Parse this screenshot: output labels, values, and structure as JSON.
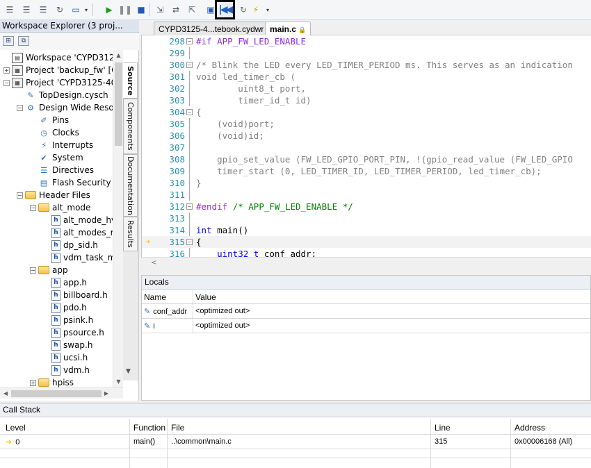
{
  "workspace_explorer": {
    "title": "Workspace Explorer (3 proj...",
    "tree": [
      {
        "label": "Workspace 'CYPD3125-40",
        "icon": "workspace-icon",
        "depth": 0,
        "expander": ""
      },
      {
        "label": "Project 'backup_fw' [C",
        "icon": "project-icon",
        "depth": 0,
        "expander": "+"
      },
      {
        "label": "Project 'CYPD3125-40",
        "icon": "project-icon",
        "depth": 0,
        "expander": "−"
      },
      {
        "label": "TopDesign.cysch",
        "icon": "schematic-icon",
        "depth": 1,
        "expander": ""
      },
      {
        "label": "Design Wide Resou",
        "icon": "dwr-icon",
        "depth": 1,
        "expander": "−"
      },
      {
        "label": "Pins",
        "icon": "pins-icon",
        "depth": 2,
        "expander": ""
      },
      {
        "label": "Clocks",
        "icon": "clock-icon",
        "depth": 2,
        "expander": ""
      },
      {
        "label": "Interrupts",
        "icon": "interrupt-icon",
        "depth": 2,
        "expander": ""
      },
      {
        "label": "System",
        "icon": "system-icon",
        "depth": 2,
        "expander": ""
      },
      {
        "label": "Directives",
        "icon": "directives-icon",
        "depth": 2,
        "expander": ""
      },
      {
        "label": "Flash Security",
        "icon": "flash-security-icon",
        "depth": 2,
        "expander": ""
      },
      {
        "label": "Header Files",
        "icon": "folder-icon",
        "depth": 1,
        "expander": "−"
      },
      {
        "label": "alt_mode",
        "icon": "folder-icon",
        "depth": 2,
        "expander": "−"
      },
      {
        "label": "alt_mode_hv",
        "icon": "header-file-icon",
        "depth": 3,
        "expander": ""
      },
      {
        "label": "alt_modes_r",
        "icon": "header-file-icon",
        "depth": 3,
        "expander": ""
      },
      {
        "label": "dp_sid.h",
        "icon": "header-file-icon",
        "depth": 3,
        "expander": ""
      },
      {
        "label": "vdm_task_m",
        "icon": "header-file-icon",
        "depth": 3,
        "expander": ""
      },
      {
        "label": "app",
        "icon": "folder-icon",
        "depth": 2,
        "expander": "−"
      },
      {
        "label": "app.h",
        "icon": "header-file-icon",
        "depth": 3,
        "expander": ""
      },
      {
        "label": "billboard.h",
        "icon": "header-file-icon",
        "depth": 3,
        "expander": ""
      },
      {
        "label": "pdo.h",
        "icon": "header-file-icon",
        "depth": 3,
        "expander": ""
      },
      {
        "label": "psink.h",
        "icon": "header-file-icon",
        "depth": 3,
        "expander": ""
      },
      {
        "label": "psource.h",
        "icon": "header-file-icon",
        "depth": 3,
        "expander": ""
      },
      {
        "label": "swap.h",
        "icon": "header-file-icon",
        "depth": 3,
        "expander": ""
      },
      {
        "label": "ucsi.h",
        "icon": "header-file-icon",
        "depth": 3,
        "expander": ""
      },
      {
        "label": "vdm.h",
        "icon": "header-file-icon",
        "depth": 3,
        "expander": ""
      },
      {
        "label": "hpiss",
        "icon": "folder-icon",
        "depth": 2,
        "expander": "+"
      }
    ],
    "side_tabs": [
      "Source",
      "Components",
      "Documentation",
      "Results"
    ]
  },
  "editor": {
    "tabs": [
      {
        "label": "CYPD3125-4...tebook.cydwr",
        "active": false
      },
      {
        "label": "main.c",
        "active": true
      }
    ],
    "lines": [
      {
        "num": "298",
        "fold": "−",
        "tokens": [
          {
            "t": "#if APP_FW_LED_ENABLE",
            "c": "pp"
          }
        ]
      },
      {
        "num": "299",
        "fold": "",
        "tokens": []
      },
      {
        "num": "300",
        "fold": "−",
        "tokens": [
          {
            "t": "/* Blink the LED every LED_TIMER_PERIOD ms. This serves as an indication",
            "c": "gray"
          }
        ]
      },
      {
        "num": "301",
        "fold": "",
        "tokens": [
          {
            "t": "void led_timer_cb (",
            "c": "gray"
          }
        ]
      },
      {
        "num": "302",
        "fold": "",
        "tokens": [
          {
            "t": "        uint8_t port,",
            "c": "gray"
          }
        ]
      },
      {
        "num": "303",
        "fold": "",
        "tokens": [
          {
            "t": "        timer_id_t id)",
            "c": "gray"
          }
        ]
      },
      {
        "num": "304",
        "fold": "−",
        "tokens": [
          {
            "t": "{",
            "c": "gray"
          }
        ]
      },
      {
        "num": "305",
        "fold": "",
        "tokens": [
          {
            "t": "    (void)port;",
            "c": "gray"
          }
        ]
      },
      {
        "num": "306",
        "fold": "",
        "tokens": [
          {
            "t": "    (void)id;",
            "c": "gray"
          }
        ]
      },
      {
        "num": "307",
        "fold": "",
        "tokens": []
      },
      {
        "num": "308",
        "fold": "",
        "tokens": [
          {
            "t": "    gpio_set_value (FW_LED_GPIO_PORT_PIN, !(gpio_read_value (FW_LED_GPIO",
            "c": "gray"
          }
        ]
      },
      {
        "num": "309",
        "fold": "",
        "tokens": [
          {
            "t": "    timer_start (0, LED_TIMER_ID, LED_TIMER_PERIOD, led_timer_cb);",
            "c": "gray"
          }
        ]
      },
      {
        "num": "310",
        "fold": "",
        "tokens": [
          {
            "t": "}",
            "c": "gray"
          }
        ]
      },
      {
        "num": "311",
        "fold": "",
        "tokens": []
      },
      {
        "num": "312",
        "fold": "−",
        "tokens": [
          {
            "t": "#endif ",
            "c": "pp"
          },
          {
            "t": "/* APP_FW_LED_ENABLE */",
            "c": "cm"
          }
        ]
      },
      {
        "num": "313",
        "fold": "",
        "tokens": []
      },
      {
        "num": "314",
        "fold": "",
        "tokens": [
          {
            "t": "int",
            "c": "kw"
          },
          {
            "t": " main()",
            "c": "plain"
          }
        ]
      },
      {
        "num": "315",
        "fold": "−",
        "tokens": [
          {
            "t": "{",
            "c": "plain"
          }
        ],
        "current": true
      },
      {
        "num": "316",
        "fold": "",
        "tokens": [
          {
            "t": "    ",
            "c": "plain"
          },
          {
            "t": "uint32_t",
            "c": "kw"
          },
          {
            "t": " conf_addr;",
            "c": "plain"
          }
        ]
      }
    ]
  },
  "locals": {
    "title": "Locals",
    "headers": [
      "Name",
      "Value"
    ],
    "rows": [
      {
        "name": "conf_addr",
        "value": "<optimized out>"
      },
      {
        "name": "i",
        "value": "<optimized out>"
      }
    ]
  },
  "call_stack": {
    "title": "Call Stack",
    "headers": [
      "Level",
      "Function",
      "File",
      "Line",
      "Address"
    ],
    "rows": [
      {
        "level": "0",
        "function": "main()",
        "file": "..\\common\\main.c",
        "line": "315",
        "address": "0x00006168 (All)"
      }
    ]
  }
}
